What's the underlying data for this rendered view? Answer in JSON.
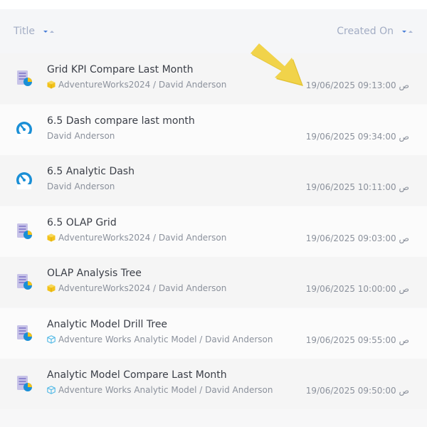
{
  "header": {
    "title_label": "Title",
    "created_label": "Created On"
  },
  "rows": [
    {
      "title": "Grid KPI Compare Last Month",
      "icon": "grid-report-icon",
      "source_icon": "yellow-cube-icon",
      "subtitle": "AdventureWorks2024 / David Anderson",
      "created": "19/06/2025 09:13:00 ص"
    },
    {
      "title": "6.5 Dash compare last month",
      "icon": "dashboard-gauge-icon",
      "source_icon": "",
      "subtitle": "David Anderson",
      "created": "19/06/2025 09:34:00 ص"
    },
    {
      "title": "6.5 Analytic Dash",
      "icon": "dashboard-gauge-icon",
      "source_icon": "",
      "subtitle": "David Anderson",
      "created": "19/06/2025 10:11:00 ص"
    },
    {
      "title": "6.5 OLAP Grid",
      "icon": "grid-report-icon",
      "source_icon": "yellow-cube-icon",
      "subtitle": "AdventureWorks2024 / David Anderson",
      "created": "19/06/2025 09:03:00 ص"
    },
    {
      "title": "OLAP Analysis Tree",
      "icon": "grid-report-icon",
      "source_icon": "yellow-cube-icon",
      "subtitle": "AdventureWorks2024 / David Anderson",
      "created": "19/06/2025 10:00:00 ص"
    },
    {
      "title": "Analytic Model Drill Tree",
      "icon": "grid-report-icon",
      "source_icon": "blue-cube-icon",
      "subtitle": "Adventure Works Analytic Model / David Anderson",
      "created": "19/06/2025 09:55:00 ص"
    },
    {
      "title": "Analytic Model Compare Last Month",
      "icon": "grid-report-icon",
      "source_icon": "blue-cube-icon",
      "subtitle": "Adventure Works Analytic Model / David Anderson",
      "created": "19/06/2025 09:50:00 ص"
    }
  ],
  "colors": {
    "accent_blue": "#1a8fd6",
    "cube_yellow": "#f2c21b",
    "cube_blue": "#4fb8e6",
    "arrow_yellow": "#f0d040",
    "header_text": "#a3adc4"
  }
}
